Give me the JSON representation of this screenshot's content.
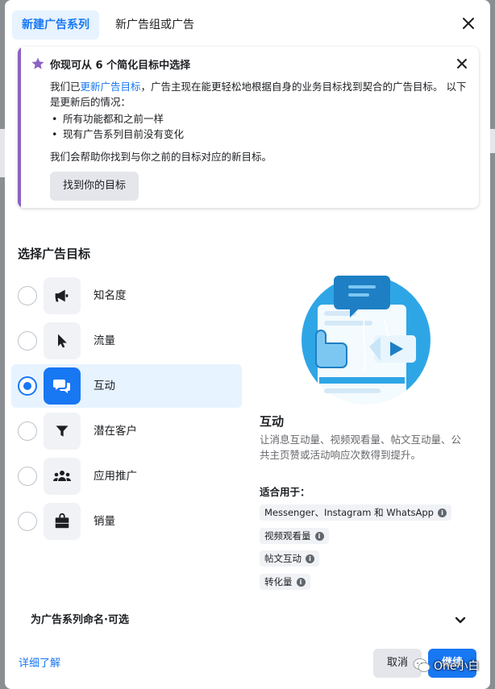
{
  "header": {
    "tabs": [
      {
        "label": "新建广告系列",
        "active": true
      },
      {
        "label": "新广告组或广告",
        "active": false
      }
    ]
  },
  "banner": {
    "title": "你现可从 6 个简化目标中选择",
    "body_prefix": "我们已",
    "body_link": "更新广告目标",
    "body_suffix": "，广告主现在能更轻松地根据自身的业务目标找到契合的广告目标。 以下是更新后的情况：",
    "bullets": [
      "所有功能都和之前一样",
      "现有广告系列目前没有变化"
    ],
    "note": "我们会帮助你找到与你之前的目标对应的新目标。",
    "button": "找到你的目标"
  },
  "objectives": {
    "title": "选择广告目标",
    "options": [
      {
        "label": "知名度",
        "icon": "megaphone-icon",
        "selected": false
      },
      {
        "label": "流量",
        "icon": "cursor-icon",
        "selected": false
      },
      {
        "label": "互动",
        "icon": "chat-bubbles-icon",
        "selected": true
      },
      {
        "label": "潜在客户",
        "icon": "funnel-icon",
        "selected": false
      },
      {
        "label": "应用推广",
        "icon": "people-icon",
        "selected": false
      },
      {
        "label": "销量",
        "icon": "shopping-bag-icon",
        "selected": false
      }
    ]
  },
  "detail": {
    "title": "互动",
    "description": "让消息互动量、视频观看量、帖文互动量、公共主页赞或活动响应次数得到提升。",
    "suitable_title": "适合用于：",
    "chips": [
      "Messenger、Instagram 和 WhatsApp",
      "视频观看量",
      "帖文互动",
      "转化量"
    ]
  },
  "name_section": {
    "label": "为广告系列命名·可选"
  },
  "footer": {
    "learn_more": "详细了解",
    "cancel": "取消",
    "continue": "继续"
  },
  "watermark": {
    "text": "One小白"
  },
  "colors": {
    "accent": "#1877f2",
    "banner_bar": "#8c62c4",
    "selected_bg": "#e7f3ff"
  }
}
